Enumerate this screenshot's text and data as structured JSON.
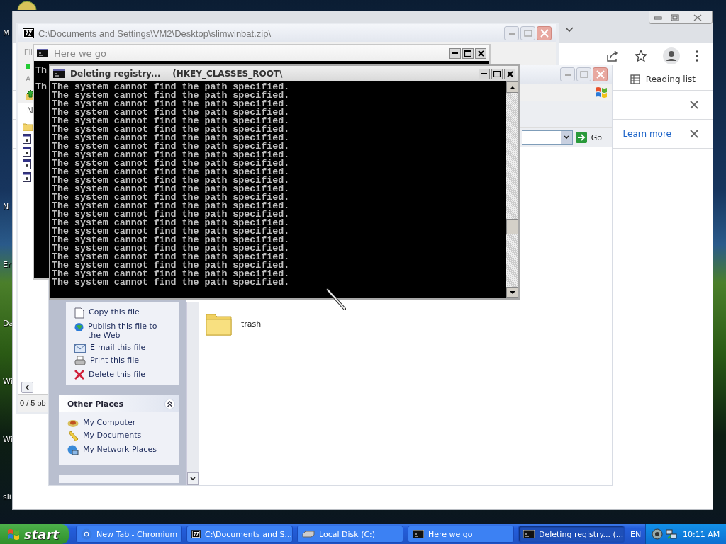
{
  "desktop": {
    "icon_labels": [
      "M",
      "N",
      "Er",
      "Da",
      "Wi",
      "Wi",
      "sli"
    ]
  },
  "chromium": {
    "reading_list": "Reading list",
    "learn_more": "Learn more"
  },
  "zip_window": {
    "title": "C:\\Documents and Settings\\VM2\\Desktop\\slimwinbat.zip\\",
    "menu": "Fil",
    "toolbar_label": "A",
    "column_header": "N",
    "status": "0 / 5 ob"
  },
  "explorer": {
    "go": "Go",
    "file_tasks": [
      {
        "label": "Copy this file"
      },
      {
        "label": "Publish this file to the Web"
      },
      {
        "label": "E-mail this file"
      },
      {
        "label": "Print this file"
      },
      {
        "label": "Delete this file"
      }
    ],
    "other_places": {
      "title": "Other Places",
      "items": [
        {
          "label": "My Computer"
        },
        {
          "label": "My Documents"
        },
        {
          "label": "My Network Places"
        }
      ]
    },
    "files": [
      {
        "name": "trash"
      }
    ]
  },
  "console_back": {
    "title": "Here we go",
    "lines": [
      "Th",
      "Th"
    ]
  },
  "console_front": {
    "title": "Deleting registry...    (HKEY_CLASSES_ROOT\\",
    "lines": [
      "The system cannot find the path specified.",
      "The system cannot find the path specified.",
      "The system cannot find the path specified.",
      "The system cannot find the path specified.",
      "The system cannot find the path specified.",
      "The system cannot find the path specified.",
      "The system cannot find the path specified.",
      "The system cannot find the path specified.",
      "The system cannot find the path specified.",
      "The system cannot find the path specified.",
      "The system cannot find the path specified.",
      "The system cannot find the path specified.",
      "The system cannot find the path specified.",
      "The system cannot find the path specified.",
      "The system cannot find the path specified.",
      "The system cannot find the path specified.",
      "The system cannot find the path specified.",
      "The system cannot find the path specified.",
      "The system cannot find the path specified.",
      "The system cannot find the path specified.",
      "The system cannot find the path specified.",
      "The system cannot find the path specified.",
      "The system cannot find the path specified.",
      "The system cannot find the path specified."
    ]
  },
  "taskbar": {
    "start": "start",
    "tasks": [
      {
        "label": "New Tab - Chromium",
        "selected": false
      },
      {
        "label": "C:\\Documents and S...",
        "selected": false
      },
      {
        "label": "Local Disk (C:)",
        "selected": false
      },
      {
        "label": "Here we go",
        "selected": false
      },
      {
        "label": "Deleting registry... (...",
        "selected": true
      }
    ],
    "language": "EN",
    "clock": "10:11 AM"
  }
}
